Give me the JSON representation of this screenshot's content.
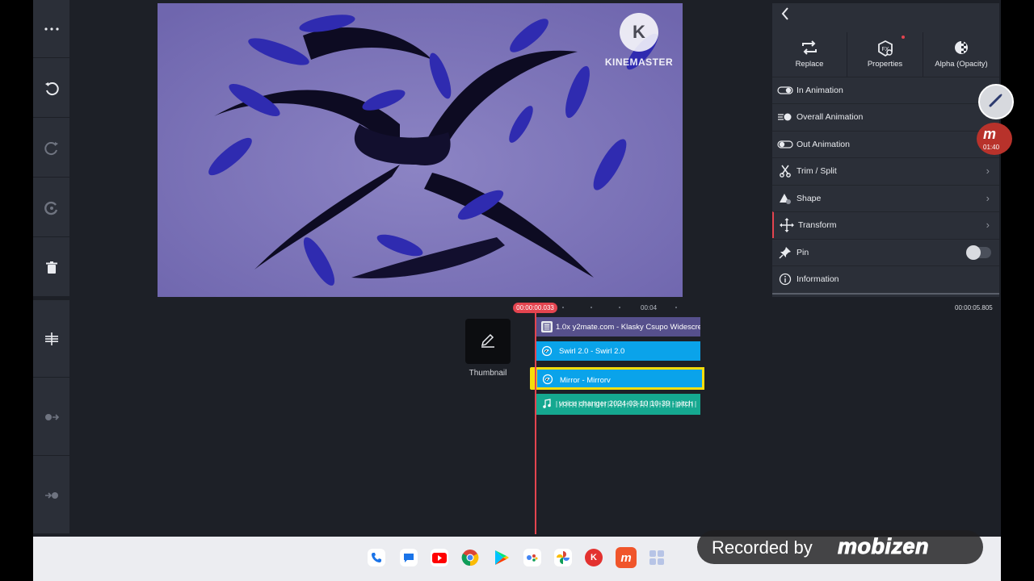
{
  "preview": {
    "watermark_logo_letter": "K",
    "watermark_text": "KINEMASTER"
  },
  "left_toolbar": {
    "top_icons": [
      "more-icon",
      "undo-icon",
      "redo-icon",
      "restore-icon",
      "delete-icon"
    ],
    "bottom_icons": [
      "split-track-icon",
      "jump-start-icon",
      "jump-end-icon"
    ]
  },
  "panel": {
    "tabs": [
      {
        "label": "Replace",
        "icon": "replace-icon"
      },
      {
        "label": "Properties",
        "icon": "properties-icon"
      },
      {
        "label": "Alpha (Opacity)",
        "icon": "opacity-icon"
      }
    ],
    "rows": [
      {
        "label": "In Animation",
        "icon": "in-animation-icon"
      },
      {
        "label": "Overall Animation",
        "icon": "overall-animation-icon"
      },
      {
        "label": "Out Animation",
        "icon": "out-animation-icon"
      },
      {
        "label": "Trim / Split",
        "icon": "scissors-icon"
      },
      {
        "label": "Shape",
        "icon": "shape-icon"
      },
      {
        "label": "Transform",
        "icon": "move-icon"
      },
      {
        "label": "Pin",
        "icon": "pin-icon"
      },
      {
        "label": "Information",
        "icon": "info-icon"
      }
    ],
    "pin_enabled": false
  },
  "overlay": {
    "recorder_letter": "m",
    "recorder_time": "01:40"
  },
  "timeline": {
    "current_time": "00:00:00.033",
    "ruler_mark": "00:04",
    "total_time": "00:00:05.805",
    "thumbnail_label": "Thumbnail",
    "clips": {
      "video": "1.0x y2mate.com - Klasky Csupo Widescreen..72",
      "swirl": "Swirl 2.0 - Swirl 2.0",
      "mirror": "Mirror - Mirrorv",
      "audio": "voice changer 2024-03-10 10-39 - pitch"
    }
  },
  "dock": {
    "apps": [
      "phone",
      "messages",
      "youtube",
      "chrome",
      "play-store",
      "assistant",
      "photos",
      "kinemaster",
      "mobizen",
      "app-grid"
    ]
  },
  "recorder_banner": {
    "text": "Recorded by",
    "brand": "mobizen"
  },
  "colors": {
    "accent_red": "#e3444f",
    "clip_blue": "#0aa3ea",
    "clip_purple": "#56508c",
    "clip_teal": "#15a890",
    "selection_yellow": "#f5dd0c"
  }
}
